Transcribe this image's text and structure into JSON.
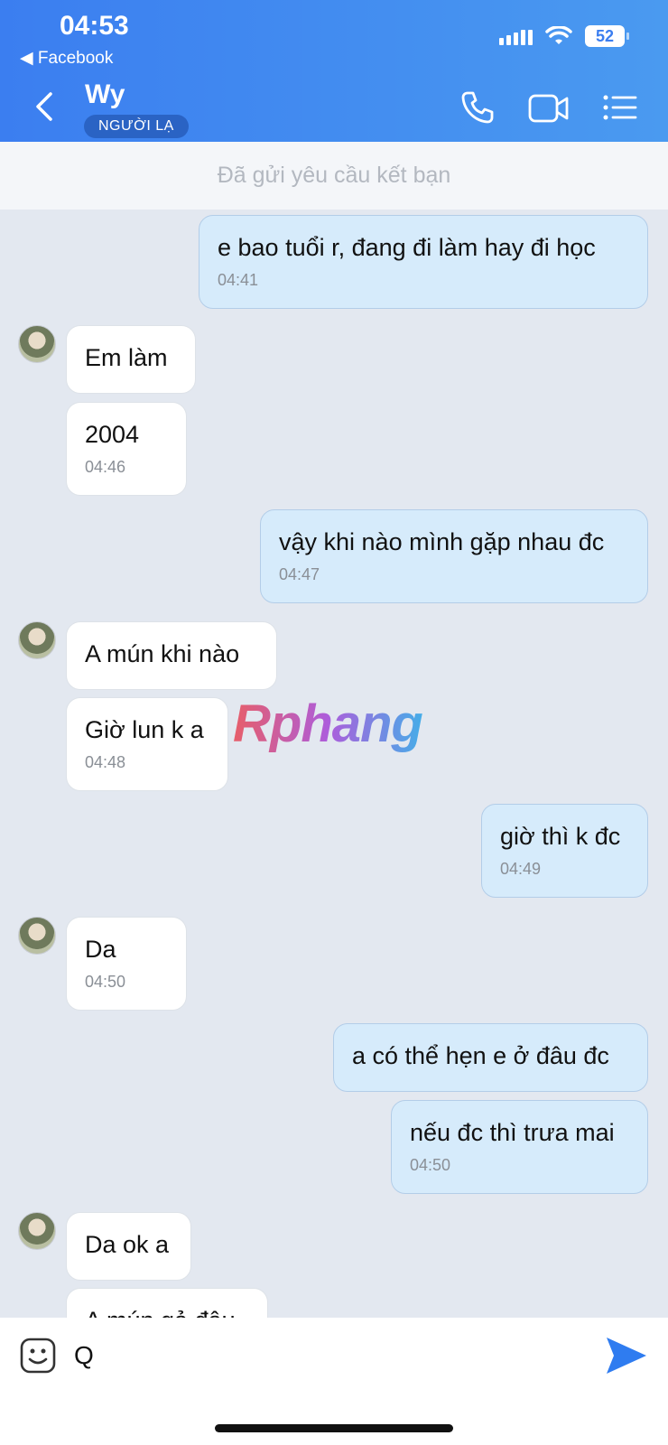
{
  "status_bar": {
    "time": "04:53",
    "back_app": "◀ Facebook",
    "battery": "52"
  },
  "header": {
    "name": "Wy",
    "badge": "NGƯỜI LẠ"
  },
  "banner": {
    "text": "Đã gửi yêu cầu kết bạn"
  },
  "messages": [
    {
      "text": "e bao tuổi r, đang đi làm hay đi học",
      "time": "04:41"
    },
    {
      "text": "Em làm"
    },
    {
      "text": "2004",
      "time": "04:46"
    },
    {
      "text": "vậy khi nào mình gặp nhau đc",
      "time": "04:47"
    },
    {
      "text": "A mún khi nào"
    },
    {
      "text": "Giờ lun k a",
      "time": "04:48"
    },
    {
      "text": "giờ thì k đc",
      "time": "04:49"
    },
    {
      "text": "Da",
      "time": "04:50"
    },
    {
      "text": "a có thể hẹn e ở đâu đc"
    },
    {
      "text": "nếu đc thì trưa mai",
      "time": "04:50"
    },
    {
      "text": "Da ok a"
    },
    {
      "text": "A mún gả đâu"
    }
  ],
  "watermark": "Rphang",
  "input": {
    "value": "Q"
  },
  "icons": [
    "back-icon",
    "phone-icon",
    "video-icon",
    "menu-icon",
    "emoji-icon",
    "send-icon",
    "signal-icon",
    "wifi-icon",
    "battery-icon"
  ]
}
